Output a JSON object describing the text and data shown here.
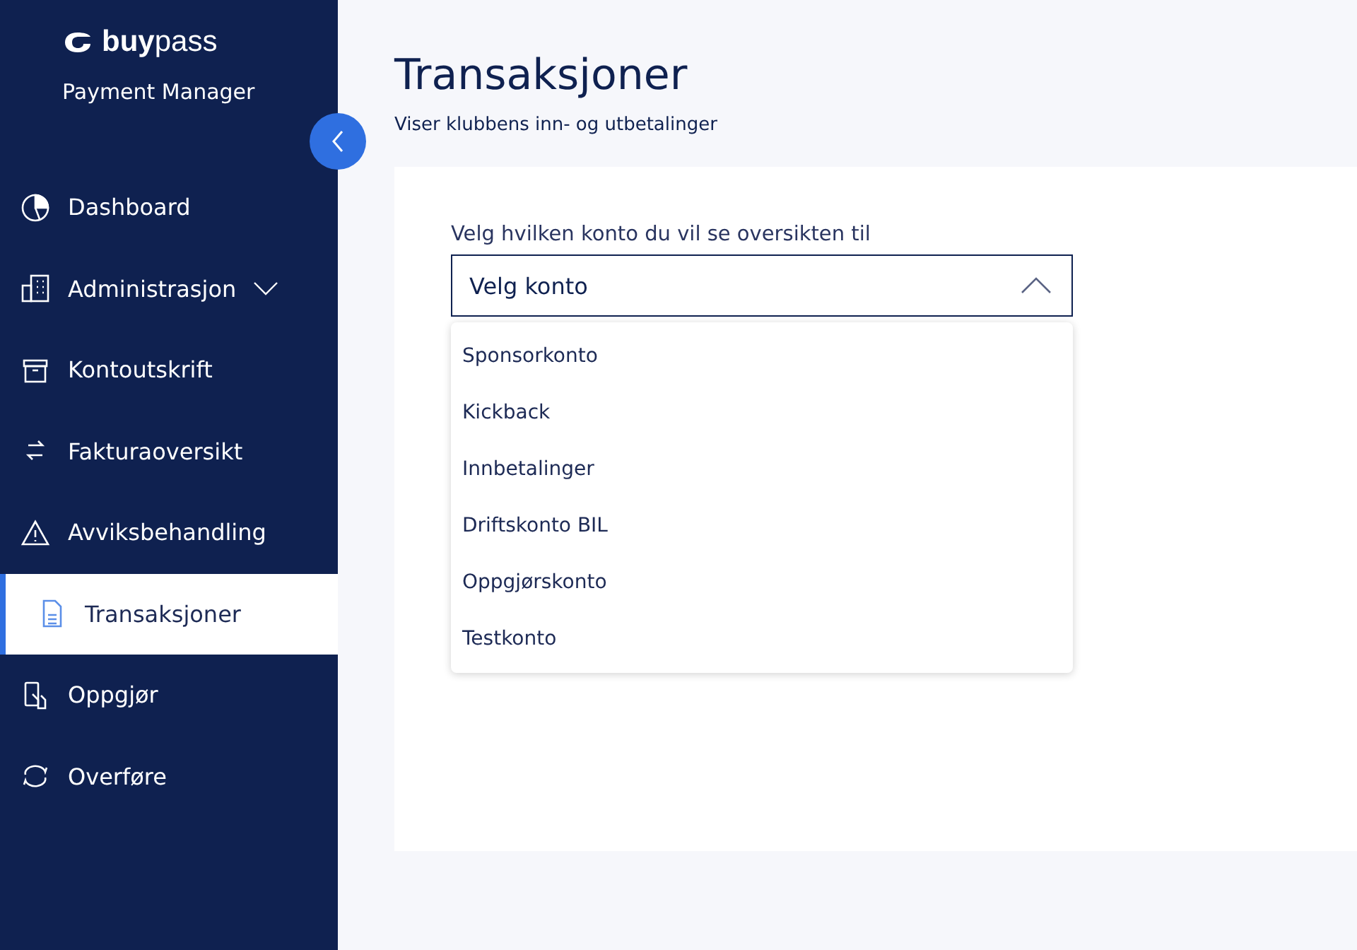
{
  "sidebar": {
    "logo": "**buy**pass",
    "product": "Payment Manager",
    "collapse": {
      "expanded": true
    },
    "items": [
      {
        "label": "Dashboard",
        "kind": "chart",
        "selected": false
      },
      {
        "label": "Administrasjon",
        "kind": "building",
        "selected": false,
        "expanded": false
      },
      {
        "label": "Kontoutskrift",
        "kind": "archive",
        "selected": false
      },
      {
        "label": "Fakturaoversikt",
        "kind": "arrows",
        "selected": false
      },
      {
        "label": "Avviksbehandling",
        "kind": "warning",
        "selected": false
      },
      {
        "label": "Transaksjoner",
        "kind": "document",
        "selected": true
      },
      {
        "label": "Oppgjør",
        "kind": "phone",
        "selected": false
      },
      {
        "label": "Overføre",
        "kind": "cycle",
        "selected": false
      }
    ]
  },
  "page": {
    "title": "Transaksjoner",
    "subtitle": "Viser klubbens inn- og utbetalinger"
  },
  "select": {
    "label": "Velg hvilken konto du vil se oversikten til",
    "placeholder": "Velg konto",
    "expanded": true,
    "options": [
      "Sponsorkonto",
      "Kickback",
      "Innbetalinger",
      "Driftskonto BIL",
      "Oppgjørskonto",
      "Testkonto"
    ]
  }
}
